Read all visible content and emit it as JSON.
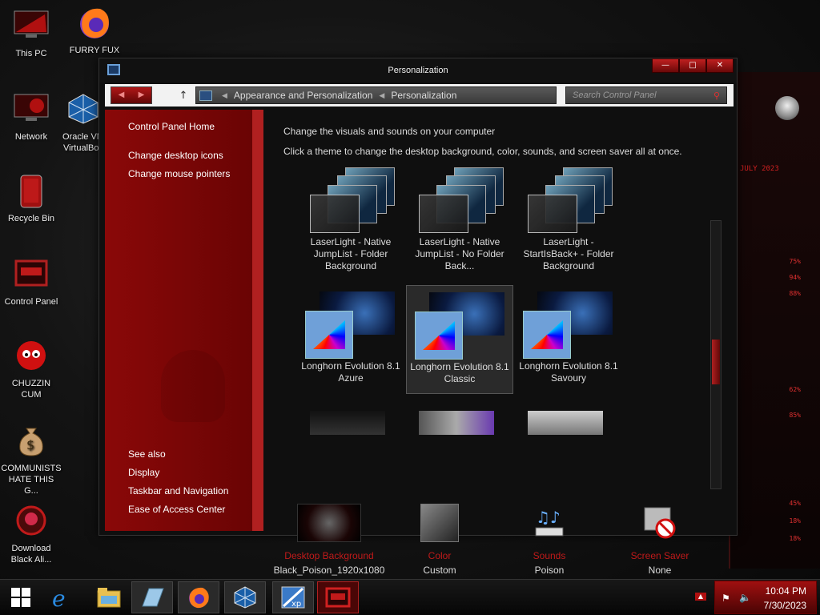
{
  "desktop": {
    "icons": [
      {
        "label": "This PC"
      },
      {
        "label": "FURRY FUX"
      },
      {
        "label": "Network"
      },
      {
        "label": "Oracle VM VirtualBox"
      },
      {
        "label": "Recycle Bin"
      },
      {
        "label": "Control Panel"
      },
      {
        "label": "CHUZZIN CUM"
      },
      {
        "label": "COMMUNISTS HATE THIS G..."
      },
      {
        "label": "Download Black Ali..."
      }
    ]
  },
  "gadget": {
    "date": "JULY 2023",
    "stats": [
      "75%",
      "94%",
      "88%",
      "62%",
      "85%",
      "45%",
      "18%",
      "18%"
    ]
  },
  "window": {
    "title": "Personalization",
    "controls": {
      "minimize": "—",
      "maximize": "□",
      "close": "✕"
    },
    "breadcrumb": [
      "Appearance and Personalization",
      "Personalization"
    ],
    "search_placeholder": "Search Control Panel"
  },
  "left_pane": {
    "home": "Control Panel Home",
    "links": [
      "Change desktop icons",
      "Change mouse pointers"
    ],
    "see_also_title": "See also",
    "see_also": [
      "Display",
      "Taskbar and Navigation",
      "Ease of Access Center"
    ]
  },
  "main": {
    "heading": "Change the visuals and sounds on your computer",
    "subheading": "Click a theme to change the desktop background, color, sounds, and screen saver all at once.",
    "themes": [
      {
        "name": "LaserLight - Native JumpList - Folder Background"
      },
      {
        "name": "LaserLight - Native JumpList - No Folder Back..."
      },
      {
        "name": "LaserLight - StartIsBack+ - Folder Background"
      },
      {
        "name": "Longhorn Evolution 8.1 Azure"
      },
      {
        "name": "Longhorn Evolution 8.1 Classic",
        "selected": true
      },
      {
        "name": "Longhorn Evolution 8.1 Savoury"
      }
    ],
    "customizations": [
      {
        "label": "Desktop Background",
        "value": "Black_Poison_1920x1080"
      },
      {
        "label": "Color",
        "value": "Custom"
      },
      {
        "label": "Sounds",
        "value": "Poison"
      },
      {
        "label": "Screen Saver",
        "value": "None"
      }
    ]
  },
  "taskbar": {
    "items": [
      "start",
      "internet-explorer",
      "file-explorer",
      "notepad",
      "firefox",
      "virtualbox",
      "windows-xp",
      "control-panel"
    ],
    "time": "10:04 PM",
    "date": "7/30/2023"
  }
}
